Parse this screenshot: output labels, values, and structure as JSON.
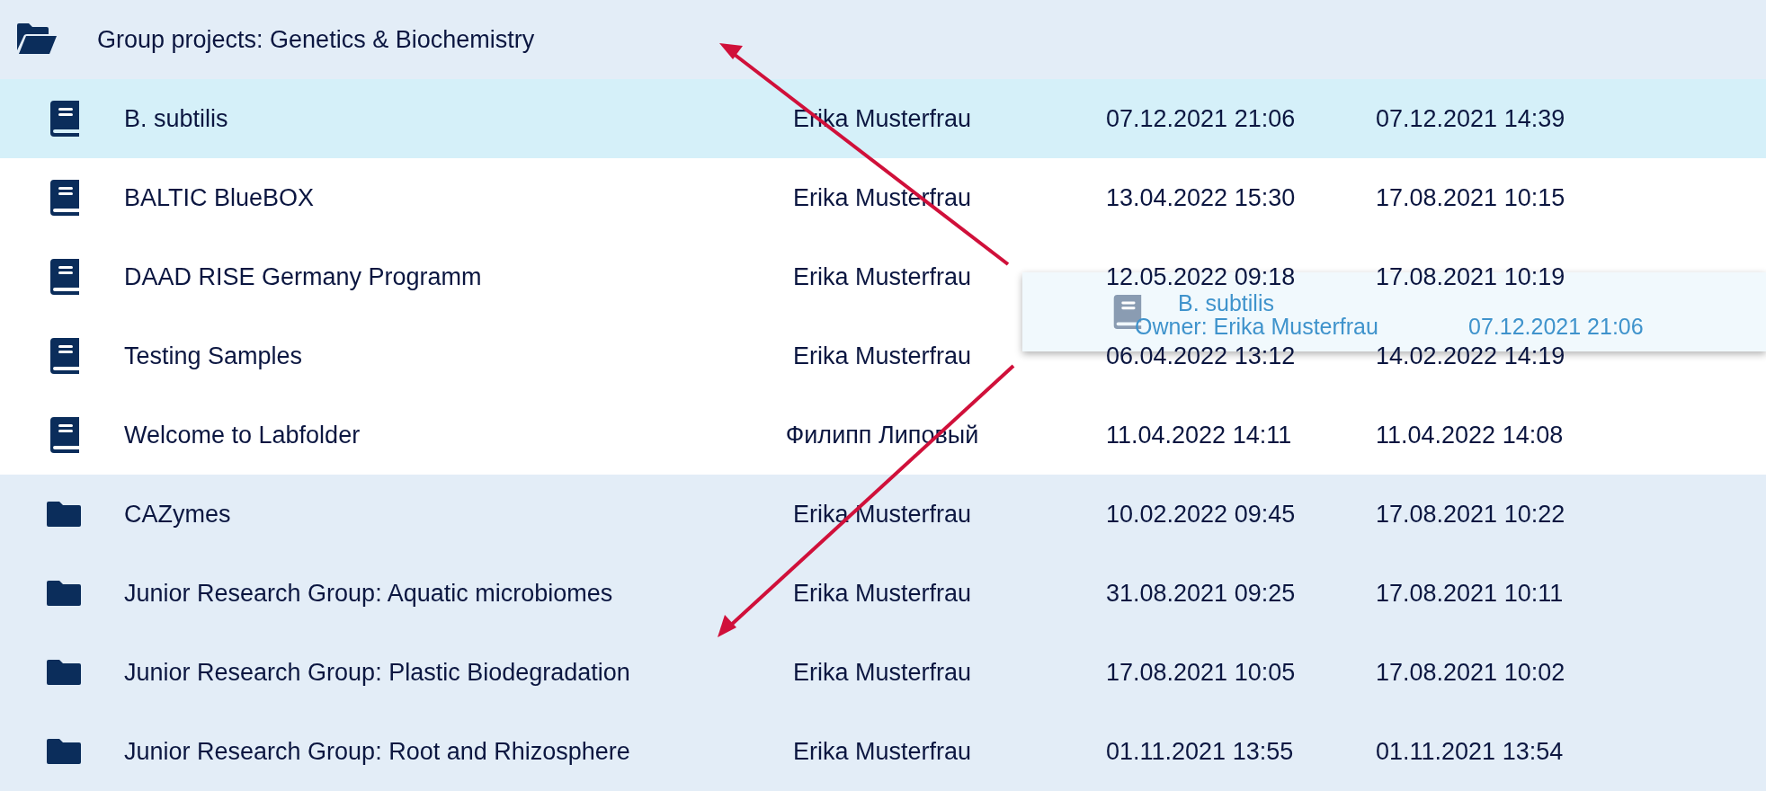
{
  "header": {
    "title": "Group projects: Genetics & Biochemistry",
    "expanded": true
  },
  "rows": [
    {
      "kind": "notebook",
      "name": "B. subtilis",
      "owner": "Erika Musterfrau",
      "modified": "07.12.2021 21:06",
      "created": "07.12.2021 14:39",
      "selected": true
    },
    {
      "kind": "notebook",
      "name": "BALTIC BlueBOX",
      "owner": "Erika Musterfrau",
      "modified": "13.04.2022 15:30",
      "created": "17.08.2021 10:15",
      "selected": false
    },
    {
      "kind": "notebook",
      "name": "DAAD RISE Germany Programm",
      "owner": "Erika Musterfrau",
      "modified": "12.05.2022 09:18",
      "created": "17.08.2021 10:19",
      "selected": false
    },
    {
      "kind": "notebook",
      "name": "Testing Samples",
      "owner": "Erika Musterfrau",
      "modified": "06.04.2022 13:12",
      "created": "14.02.2022 14:19",
      "selected": false
    },
    {
      "kind": "notebook",
      "name": "Welcome to Labfolder",
      "owner": "Филипп Липовый",
      "modified": "11.04.2022 14:11",
      "created": "11.04.2022 14:08",
      "selected": false
    },
    {
      "kind": "folder",
      "name": "CAZymes",
      "owner": "Erika Musterfrau",
      "modified": "10.02.2022 09:45",
      "created": "17.08.2021 10:22",
      "selected": false
    },
    {
      "kind": "folder",
      "name": "Junior Research Group: Aquatic microbiomes",
      "owner": "Erika Musterfrau",
      "modified": "31.08.2021 09:25",
      "created": "17.08.2021 10:11",
      "selected": false
    },
    {
      "kind": "folder",
      "name": "Junior Research Group: Plastic Biodegradation",
      "owner": "Erika Musterfrau",
      "modified": "17.08.2021 10:05",
      "created": "17.08.2021 10:02",
      "selected": false
    },
    {
      "kind": "folder",
      "name": "Junior Research Group: Root and Rhizosphere",
      "owner": "Erika Musterfrau",
      "modified": "01.11.2021 13:55",
      "created": "01.11.2021 13:54",
      "selected": false
    }
  ],
  "drag_preview": {
    "kind": "notebook",
    "name": "B. subtilis",
    "owner": "Owner: Erika Musterfrau",
    "modified": "07.12.2021 21:06"
  }
}
